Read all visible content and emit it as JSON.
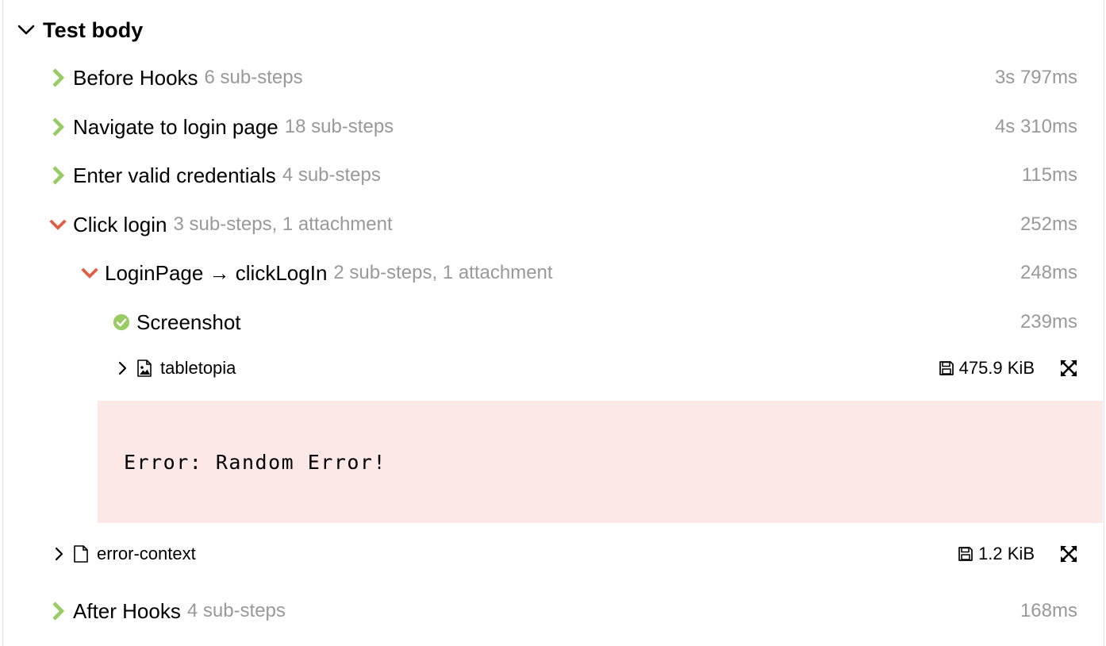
{
  "section": {
    "title": "Test body",
    "chevron_icon": "chevron-down-icon"
  },
  "steps": [
    {
      "name": "Before Hooks",
      "meta": "6 sub-steps",
      "duration": "3s 797ms",
      "status": "passed",
      "icon": "chevron-right-icon"
    },
    {
      "name": "Navigate to login page",
      "meta": "18 sub-steps",
      "duration": "4s 310ms",
      "status": "passed",
      "icon": "chevron-right-icon"
    },
    {
      "name": "Enter valid credentials",
      "meta": "4 sub-steps",
      "duration": "115ms",
      "status": "passed",
      "icon": "chevron-right-icon"
    },
    {
      "name": "Click login",
      "meta": "3 sub-steps, 1 attachment",
      "duration": "252ms",
      "status": "failed",
      "icon": "chevron-down-icon"
    },
    {
      "name": "LoginPage → clickLogIn",
      "meta": "2 sub-steps, 1 attachment",
      "duration": "248ms",
      "status": "failed",
      "icon": "chevron-down-icon"
    },
    {
      "name": "Screenshot",
      "meta": "",
      "duration": "239ms",
      "status": "passed",
      "icon": "check-circle-icon"
    },
    {
      "name": "After Hooks",
      "meta": "4 sub-steps",
      "duration": "168ms",
      "status": "passed",
      "icon": "chevron-right-icon"
    }
  ],
  "attachments": [
    {
      "name": "tabletopia",
      "size": "475.9 KiB",
      "type_icon": "image-file-icon"
    },
    {
      "name": "error-context",
      "size": "1.2 KiB",
      "type_icon": "document-file-icon"
    }
  ],
  "error": {
    "message": "Error: Random Error!"
  },
  "colors": {
    "passed": "#97cc64",
    "failed": "#e05d44",
    "meta_text": "#999999",
    "error_bg": "#fce8e6"
  }
}
